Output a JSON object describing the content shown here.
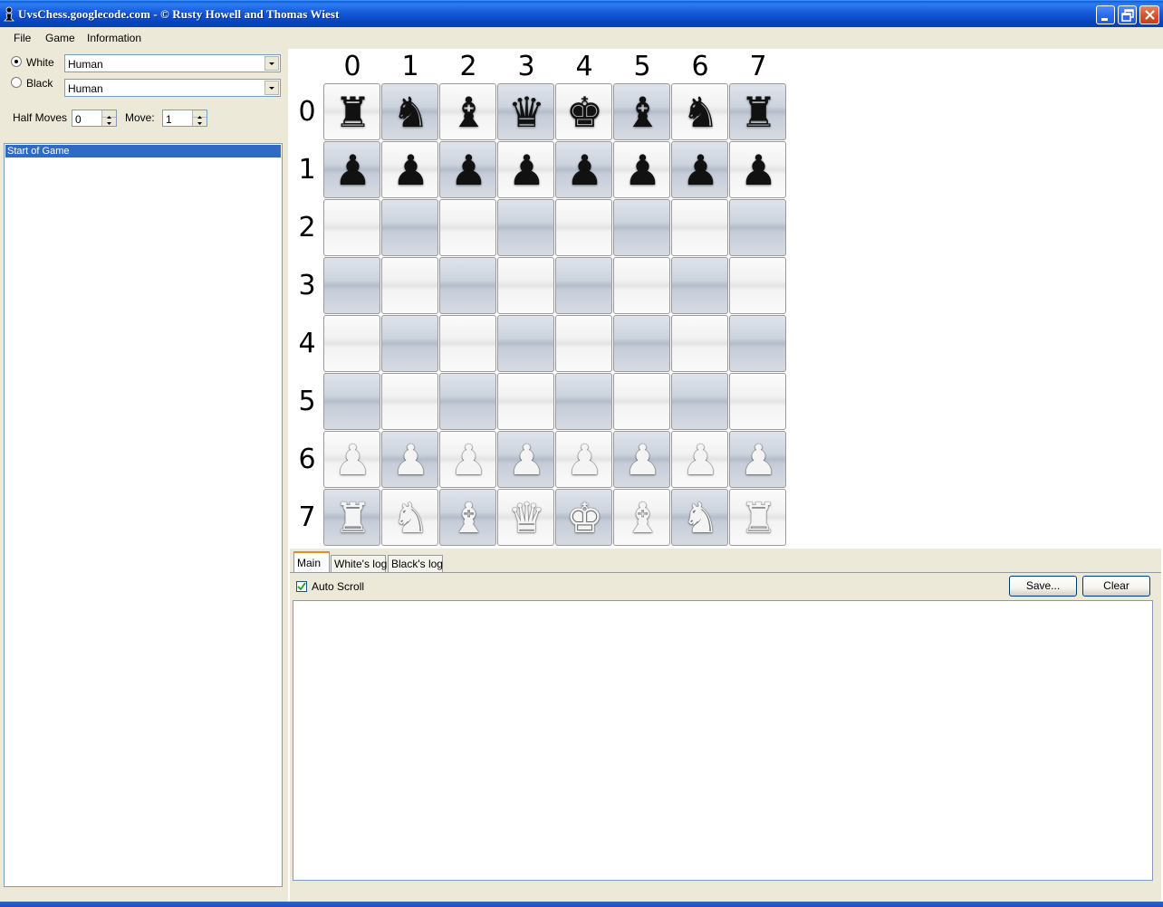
{
  "window": {
    "title": "UvsChess.googlecode.com - © Rusty Howell and Thomas Wiest"
  },
  "menu": {
    "items": [
      "File",
      "Game",
      "Information"
    ]
  },
  "players": {
    "white_label": "White",
    "white_selected": true,
    "white_value": "Human",
    "black_label": "Black",
    "black_selected": false,
    "black_value": "Human"
  },
  "counters": {
    "half_moves_label": "Half Moves",
    "half_moves_value": "0",
    "move_label": "Move:",
    "move_value": "1"
  },
  "move_list": {
    "items": [
      "Start of Game"
    ],
    "selected_index": 0
  },
  "board": {
    "col_labels": [
      "0",
      "1",
      "2",
      "3",
      "4",
      "5",
      "6",
      "7"
    ],
    "row_labels": [
      "0",
      "1",
      "2",
      "3",
      "4",
      "5",
      "6",
      "7"
    ],
    "rows": [
      [
        "r",
        "n",
        "b",
        "q",
        "k",
        "b",
        "n",
        "r"
      ],
      [
        "p",
        "p",
        "p",
        "p",
        "p",
        "p",
        "p",
        "p"
      ],
      [
        "",
        "",
        "",
        "",
        "",
        "",
        "",
        ""
      ],
      [
        "",
        "",
        "",
        "",
        "",
        "",
        "",
        ""
      ],
      [
        "",
        "",
        "",
        "",
        "",
        "",
        "",
        ""
      ],
      [
        "",
        "",
        "",
        "",
        "",
        "",
        "",
        ""
      ],
      [
        "P",
        "P",
        "P",
        "P",
        "P",
        "P",
        "P",
        "P"
      ],
      [
        "R",
        "N",
        "B",
        "Q",
        "K",
        "B",
        "N",
        "R"
      ]
    ]
  },
  "log": {
    "tabs": [
      "Main",
      "White's log",
      "Black's log"
    ],
    "active_tab": 0,
    "auto_scroll_label": "Auto Scroll",
    "auto_scroll_checked": true,
    "save_label": "Save...",
    "clear_label": "Clear",
    "content": ""
  },
  "colors": {
    "titlebar": "#0a4fd0",
    "chrome": "#ece9d8",
    "selection": "#316ac5"
  }
}
